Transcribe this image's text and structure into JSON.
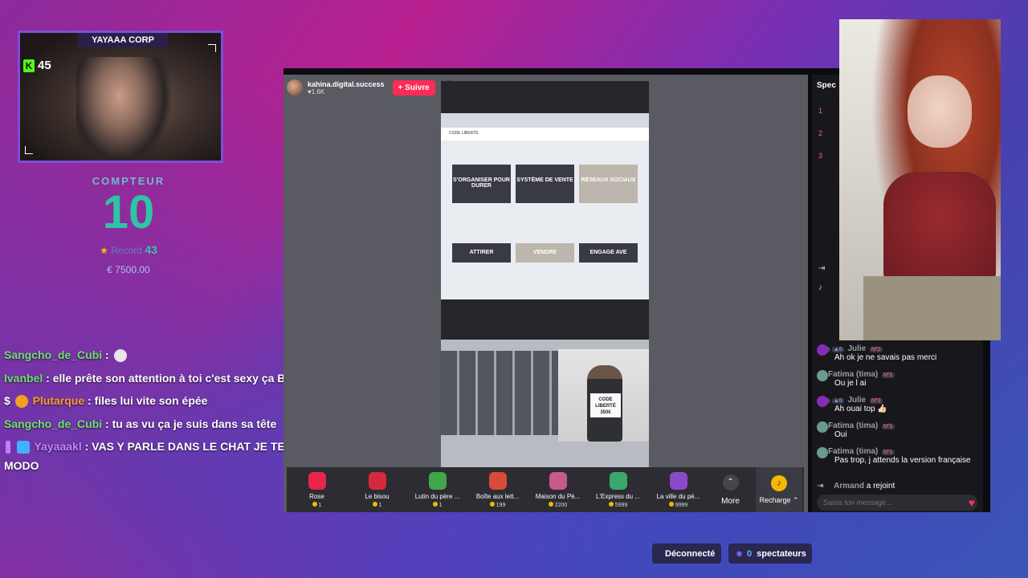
{
  "webcam": {
    "title": "YAYAAA CORP",
    "k_logo": "K",
    "k_count": "45"
  },
  "counter": {
    "label": "COMPTEUR",
    "value": "10",
    "record_label": "Record",
    "record_value": "43",
    "money": "€ 7500.00"
  },
  "stream_chat": [
    {
      "user": "Sangcho_de_Cubi",
      "sep": " :",
      "text": ""
    },
    {
      "user": "Ivanbel",
      "sep": " : ",
      "text": "elle prête son attention à toi c'est sexy ça BG"
    },
    {
      "badge": "$",
      "user": "Plutarque",
      "sep": " : ",
      "text": "files lui vite son épée"
    },
    {
      "user": "Sangcho_de_Cubi",
      "sep": " : ",
      "text": "tu as vu ça je suis dans sa tête"
    },
    {
      "user": "Yayaaakl",
      "sep": " : ",
      "text": "VAS Y PARLE DANS LE CHAT JE TE MET MODO"
    }
  ],
  "tiktok": {
    "username": "kahina.digital.success",
    "likes": "♥1.6K",
    "follow_label": "+ Suivre",
    "video": {
      "site_header": "CODE LIBERTÉ",
      "cards": [
        "S'ORGANISER POUR DURER",
        "SYSTÈME DE VENTE",
        "RÉSEAUX SOCIAUX"
      ],
      "bottom_cards": [
        "ATTIRER",
        "VENDRE",
        "ENGAGE AVE"
      ],
      "sign": "CODE LIBERTÉ 350€"
    },
    "gifts": [
      {
        "name": "Rose",
        "price": "1",
        "color": "#e8264a"
      },
      {
        "name": "Le bisou",
        "price": "1",
        "color": "#d62a3c"
      },
      {
        "name": "Lutin du père ...",
        "price": "1",
        "color": "#3fa64a"
      },
      {
        "name": "Boîte aux lett...",
        "price": "199",
        "color": "#d84a3a"
      },
      {
        "name": "Maison du Pè...",
        "price": "2200",
        "color": "#c85a8a"
      },
      {
        "name": "L'Express du ...",
        "price": "5999",
        "color": "#3aa86a"
      },
      {
        "name": "La ville du pè...",
        "price": "9999",
        "color": "#8a4ac8"
      }
    ],
    "more_label": "More",
    "recharge_label": "Recharge ⌃",
    "chat": {
      "header": "Spec",
      "messages": [
        {
          "user": "Julie",
          "badge": "Nº2",
          "text": "Ah ok je ne savais pas merci"
        },
        {
          "user": "Fatima (tima)",
          "badge": "Nº1",
          "text": "Ou je l ai"
        },
        {
          "user": "Julie",
          "badge": "Nº2",
          "text": "Ah ouai top 👍🏻"
        },
        {
          "user": "Fatima (tima)",
          "badge": "Nº1",
          "text": "Oui"
        },
        {
          "user": "Fatima (tima)",
          "badge": "Nº1",
          "text": "Pas trop, j attends la version française"
        }
      ],
      "join": {
        "user": "Armand",
        "text": "a rejoint"
      },
      "input_placeholder": "Saisis ton message..."
    }
  },
  "status": {
    "connection": "Déconnecté",
    "viewers_count": "0",
    "viewers_label": "spectateurs"
  }
}
